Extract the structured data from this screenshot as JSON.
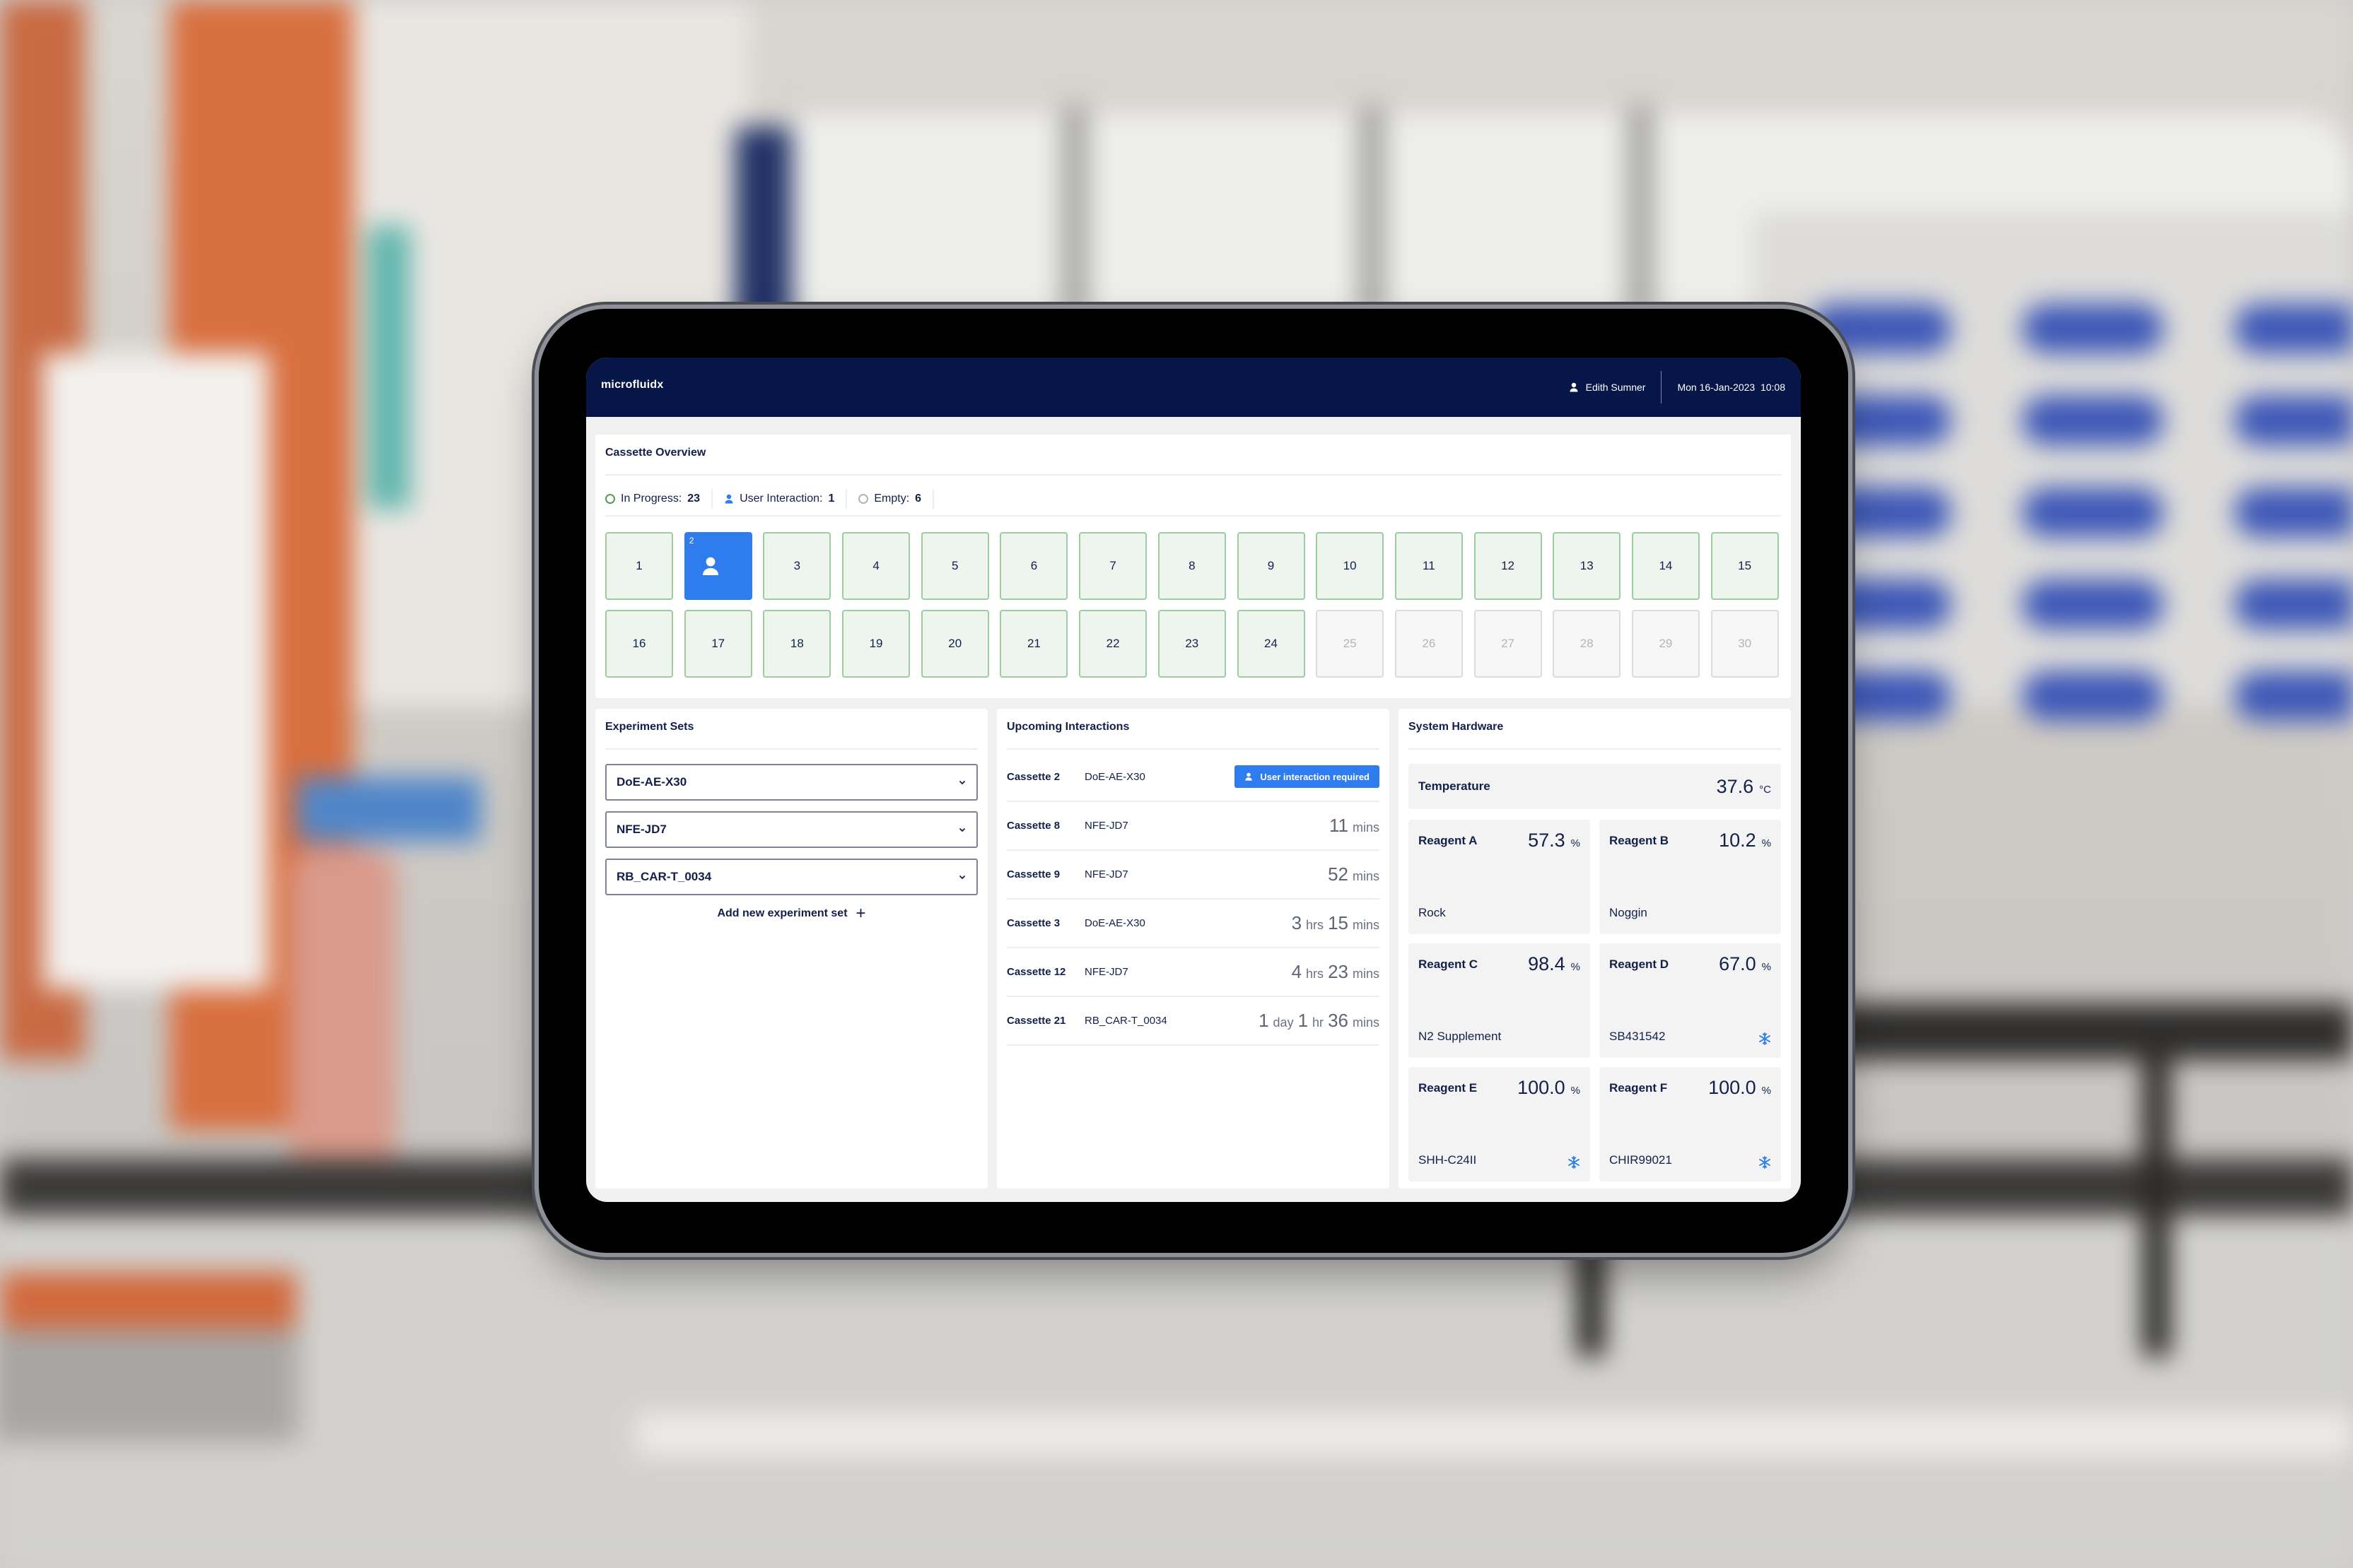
{
  "header": {
    "logo": "microfluidx",
    "user_name": "Edith Sumner",
    "datetime": "Mon 16-Jan-2023  10:08"
  },
  "cassette_overview": {
    "title": "Cassette Overview",
    "legend": {
      "in_progress_label": "In Progress:",
      "in_progress_count": "23",
      "user_interaction_label": "User Interaction:",
      "user_interaction_count": "1",
      "empty_label": "Empty:",
      "empty_count": "6"
    },
    "cassettes": [
      {
        "id": "1",
        "status": "in_progress"
      },
      {
        "id": "2",
        "status": "user_interaction"
      },
      {
        "id": "3",
        "status": "in_progress"
      },
      {
        "id": "4",
        "status": "in_progress"
      },
      {
        "id": "5",
        "status": "in_progress"
      },
      {
        "id": "6",
        "status": "in_progress"
      },
      {
        "id": "7",
        "status": "in_progress"
      },
      {
        "id": "8",
        "status": "in_progress"
      },
      {
        "id": "9",
        "status": "in_progress"
      },
      {
        "id": "10",
        "status": "in_progress"
      },
      {
        "id": "11",
        "status": "in_progress"
      },
      {
        "id": "12",
        "status": "in_progress"
      },
      {
        "id": "13",
        "status": "in_progress"
      },
      {
        "id": "14",
        "status": "in_progress"
      },
      {
        "id": "15",
        "status": "in_progress"
      },
      {
        "id": "16",
        "status": "in_progress"
      },
      {
        "id": "17",
        "status": "in_progress"
      },
      {
        "id": "18",
        "status": "in_progress"
      },
      {
        "id": "19",
        "status": "in_progress"
      },
      {
        "id": "20",
        "status": "in_progress"
      },
      {
        "id": "21",
        "status": "in_progress"
      },
      {
        "id": "22",
        "status": "in_progress"
      },
      {
        "id": "23",
        "status": "in_progress"
      },
      {
        "id": "24",
        "status": "in_progress"
      },
      {
        "id": "25",
        "status": "empty"
      },
      {
        "id": "26",
        "status": "empty"
      },
      {
        "id": "27",
        "status": "empty"
      },
      {
        "id": "28",
        "status": "empty"
      },
      {
        "id": "29",
        "status": "empty"
      },
      {
        "id": "30",
        "status": "empty"
      }
    ]
  },
  "experiment_sets": {
    "title": "Experiment Sets",
    "sets": [
      "DoE-AE-X30",
      "NFE-JD7",
      "RB_CAR-T_0034"
    ],
    "add_label": "Add new experiment set",
    "add_icon": "+"
  },
  "upcoming_interactions": {
    "title": "Upcoming Interactions",
    "badge_label": "User interaction required",
    "rows": [
      {
        "cassette": "Cassette 2",
        "set": "DoE-AE-X30",
        "badge": true,
        "time": []
      },
      {
        "cassette": "Cassette 8",
        "set": "NFE-JD7",
        "badge": false,
        "time": [
          [
            "11",
            "mins"
          ]
        ]
      },
      {
        "cassette": "Cassette 9",
        "set": "NFE-JD7",
        "badge": false,
        "time": [
          [
            "52",
            "mins"
          ]
        ]
      },
      {
        "cassette": "Cassette 3",
        "set": "DoE-AE-X30",
        "badge": false,
        "time": [
          [
            "3",
            "hrs"
          ],
          [
            "15",
            "mins"
          ]
        ]
      },
      {
        "cassette": "Cassette 12",
        "set": "NFE-JD7",
        "badge": false,
        "time": [
          [
            "4",
            "hrs"
          ],
          [
            "23",
            "mins"
          ]
        ]
      },
      {
        "cassette": "Cassette 21",
        "set": "RB_CAR-T_0034",
        "badge": false,
        "time": [
          [
            "1",
            "day"
          ],
          [
            "1",
            "hr"
          ],
          [
            "36",
            "mins"
          ]
        ]
      }
    ]
  },
  "system_hardware": {
    "title": "System Hardware",
    "temperature": {
      "label": "Temperature",
      "value": "37.6",
      "unit": "°C"
    },
    "reagents": [
      {
        "name": "Reagent A",
        "value": "57.3",
        "unit": "%",
        "substance": "Rock",
        "frozen": false
      },
      {
        "name": "Reagent B",
        "value": "10.2",
        "unit": "%",
        "substance": "Noggin",
        "frozen": false
      },
      {
        "name": "Reagent C",
        "value": "98.4",
        "unit": "%",
        "substance": "N2 Supplement",
        "frozen": false
      },
      {
        "name": "Reagent D",
        "value": "67.0",
        "unit": "%",
        "substance": "SB431542",
        "frozen": true
      },
      {
        "name": "Reagent E",
        "value": "100.0",
        "unit": "%",
        "substance": "SHH-C24II",
        "frozen": true
      },
      {
        "name": "Reagent F",
        "value": "100.0",
        "unit": "%",
        "substance": "CHIR99021",
        "frozen": true
      }
    ]
  },
  "colors": {
    "header_bg": "#061649",
    "accent_blue": "#2e7cee",
    "in_progress_border": "#9ccc9f",
    "in_progress_fill": "#eef5ee",
    "empty_border": "#dcdcdc",
    "text_dark": "#13204a"
  }
}
